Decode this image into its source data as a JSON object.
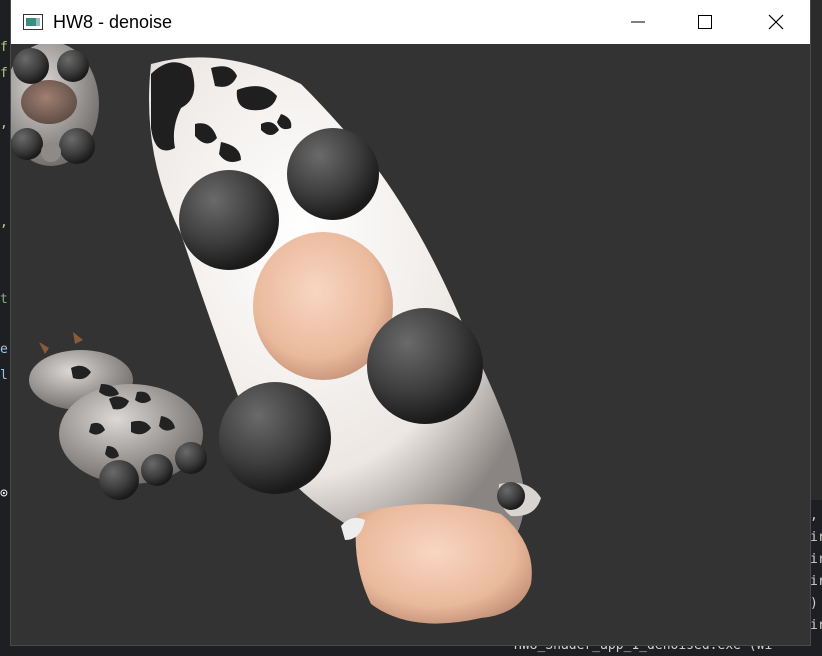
{
  "window": {
    "title": "HW8 - denoise",
    "controls": {
      "minimize": "minimize-icon",
      "maximize": "maximize-icon",
      "close": "close-icon"
    }
  },
  "background": {
    "status_line": "HW8_Shader_app_1_denoised.exe  (Wi"
  },
  "colors": {
    "titlebar": "#ffffff",
    "viewport_bg": "#333333",
    "cow_white": "#f4f1ee",
    "cow_spot": "#2b2b2b",
    "hoof": "#4a4a4a",
    "muzzle": "#f0c6ab"
  }
}
